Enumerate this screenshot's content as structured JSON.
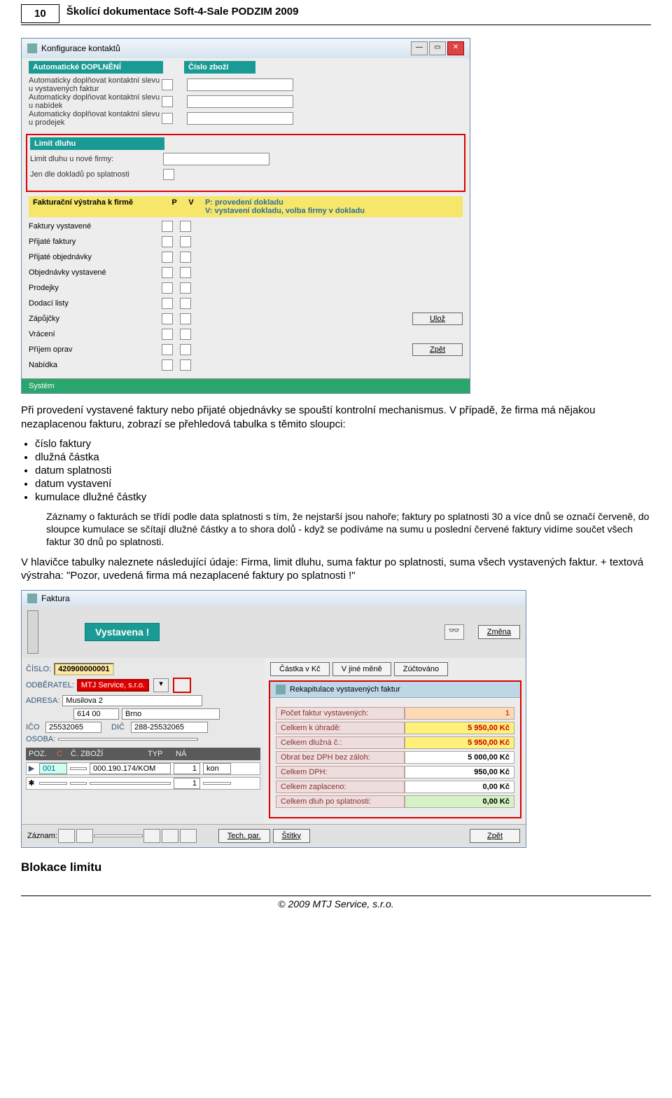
{
  "header": {
    "page_num": "10",
    "title": "Školící dokumentace Soft-4-Sale PODZIM 2009"
  },
  "config_win": {
    "title": "Konfigurace kontaktů",
    "sec_auto": "Automatické DOPLNĚNÍ",
    "sec_zbozi": "Číslo zboží",
    "auto_rows": [
      "Automaticky doplňovat kontaktní slevu u vystavených faktur",
      "Automaticky doplňovat kontaktní slevu u nabídek",
      "Automaticky doplňovat kontaktní slevu u prodejek"
    ],
    "limit_hdr": "Limit dluhu",
    "limit_rows": [
      "Limit dluhu u nové firmy:",
      "Jen dle dokladů po splatnosti"
    ],
    "vystraha_hdr": "Fakturační výstraha k firmě",
    "p": "P",
    "v": "V",
    "hint1": "P: provedení dokladu",
    "hint2": "V: vystavení dokladu, volba firmy v dokladu",
    "check_rows": [
      "Faktury vystavené",
      "Přijaté faktury",
      "Přijaté objednávky",
      "Objednávky vystavené",
      "Prodejky",
      "Dodací listy",
      "Zápůjčky",
      "Vrácení",
      "Příjem oprav",
      "Nabídka"
    ],
    "btn_uloz": "Ulož",
    "btn_zpet": "Zpět",
    "system": "Systém"
  },
  "para1": "Při provedení vystavené faktury nebo přijaté objednávky se spouští kontrolní mechanismus. V případě, že  firma má nějakou nezaplacenou fakturu, zobrazí se přehledová tabulka s těmito sloupci:",
  "bullets": [
    "číslo faktury",
    "dlužná částka",
    "datum splatnosti",
    "datum vystavení",
    "kumulace dlužné částky"
  ],
  "indent": "Záznamy o fakturách se třídí podle data splatnosti s tím, že nejstarší jsou nahoře; faktury po splatnosti 30 a více dnů se označí červeně, do sloupce kumulace se sčítají dlužné částky a to shora dolů - když se podíváme na sumu u poslední červené faktury vidíme součet všech faktur 30 dnů po splatnosti.",
  "para2": "V hlavičce tabulky naleznete následující údaje: Firma, limit dluhu, suma faktur po splatnosti, suma všech vystavených faktur. + textová výstraha: \"Pozor, uvedená firma má nezaplacené faktury po splatnosti !\"",
  "fak": {
    "win_title": "Faktura",
    "vystavena": "Vystavena !",
    "zmena": "Změna",
    "castka": "Částka v Kč",
    "jina_mena": "V jiné měně",
    "zuct": "Zúčtováno",
    "cislo_l": "ČÍSLO:",
    "cislo_v": "420900000001",
    "odb_l": "ODBĚRATEL:",
    "odb_v": "MTJ Service, s.r.o.",
    "adr_l": "ADRESA:",
    "adr_v": "Musilova 2",
    "psc": "614 00",
    "mesto": "Brno",
    "ico_l": "IČO",
    "ico_v": "25532065",
    "dic_l": "DIČ",
    "dic_v": "288-25532065",
    "osoba_l": "OSOBA:",
    "hdr_poz": "POZ.",
    "hdr_c": "C",
    "hdr_zbozi": "Č. ZBOŽÍ",
    "hdr_typ": "TYP",
    "hdr_na": "NÁ",
    "row_poz": "001",
    "row_zbozi": "000.190.174/KOM",
    "row_qty": "1",
    "row_na": "kon",
    "rec_title": "Rekapitulace vystavených faktur",
    "rec": [
      {
        "l": "Počet faktur vystavených:",
        "v": "1",
        "cls": "peach"
      },
      {
        "l": "Celkem k úhradě:",
        "v": "5 950,00 Kč",
        "cls": "yellow"
      },
      {
        "l": "Celkem dlužná č.:",
        "v": "5 950,00 Kč",
        "cls": "yellow"
      },
      {
        "l": "Obrat bez DPH bez záloh:",
        "v": "5 000,00 Kč",
        "cls": ""
      },
      {
        "l": "Celkem DPH:",
        "v": "950,00 Kč",
        "cls": ""
      },
      {
        "l": "Celkem zaplaceno:",
        "v": "0,00 Kč",
        "cls": ""
      },
      {
        "l": "Celkem dluh po splatnosti:",
        "v": "0,00 Kč",
        "cls": "green"
      }
    ],
    "zaznam": "Záznam:",
    "tech": "Tech. par.",
    "stitky": "Štítky",
    "zpet": "Zpět"
  },
  "h2": "Blokace limitu",
  "footer": "© 2009 MTJ Service, s.r.o."
}
